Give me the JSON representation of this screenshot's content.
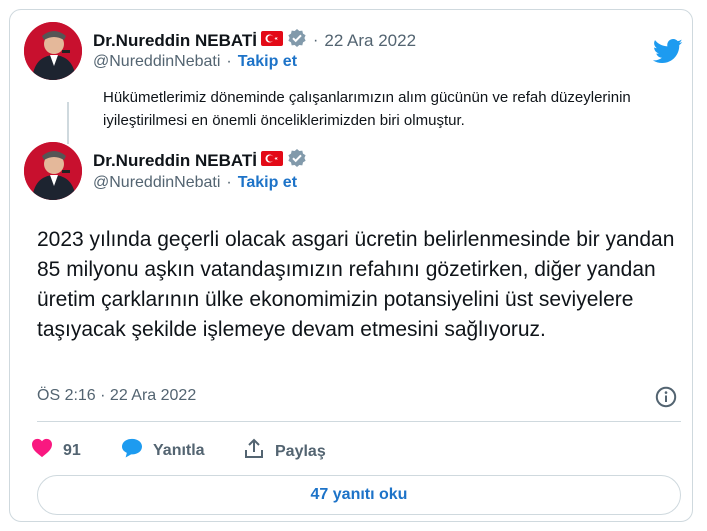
{
  "quoted_tweet": {
    "author_name": "Dr.Nureddin NEBATİ",
    "handle": "@NureddinNebati",
    "separator": "·",
    "date": "22 Ara 2022",
    "follow_label": "Takip et",
    "text": "Hükümetlerimiz döneminde çalışanlarımızın alım gücünün ve refah düzeylerinin iyileştirilmesi en önemli önceliklerimizden biri olmuştur."
  },
  "main_tweet": {
    "author_name": "Dr.Nureddin NEBATİ",
    "handle": "@NureddinNebati",
    "separator": "·",
    "follow_label": "Takip et",
    "text": "2023 yılında geçerli olacak asgari ücretin belirlenmesinde bir yandan 85 milyonu aşkın vatandaşımızın refahını gözetirken, diğer yandan üretim çarklarının ülke ekonomimizin potansiyelini üst seviyelere taşıyacak şekilde işlemeye devam etmesini sağlıyoruz.",
    "timestamp": "ÖS 2:16 · 22 Ara 2022"
  },
  "actions": {
    "like_count": "91",
    "reply_label": "Yanıtla",
    "share_label": "Paylaş"
  },
  "read_replies_label": "47 yanıtı oku",
  "icons": {
    "brand": "twitter-bird-icon",
    "verified": "verified-badge-icon",
    "flag": "turkey-flag-icon",
    "info": "info-icon",
    "like": "heart-icon",
    "reply": "speech-bubble-icon",
    "share": "share-icon"
  },
  "colors": {
    "accent": "#1d9bf0",
    "link": "#1d73c8",
    "like": "#f91880",
    "muted": "#536471",
    "border": "#cfd9de"
  }
}
